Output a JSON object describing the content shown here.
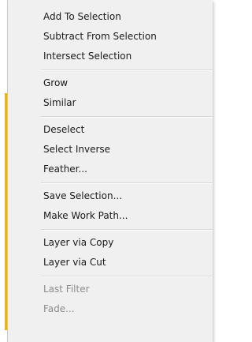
{
  "menu": {
    "groups": [
      {
        "items": [
          {
            "label": "Add To Selection",
            "enabled": true
          },
          {
            "label": "Subtract From Selection",
            "enabled": true
          },
          {
            "label": "Intersect Selection",
            "enabled": true
          }
        ]
      },
      {
        "items": [
          {
            "label": "Grow",
            "enabled": true
          },
          {
            "label": "Similar",
            "enabled": true
          }
        ]
      },
      {
        "items": [
          {
            "label": "Deselect",
            "enabled": true
          },
          {
            "label": "Select Inverse",
            "enabled": true
          },
          {
            "label": "Feather...",
            "enabled": true
          }
        ]
      },
      {
        "items": [
          {
            "label": "Save Selection...",
            "enabled": true
          },
          {
            "label": "Make Work Path...",
            "enabled": true
          }
        ]
      },
      {
        "items": [
          {
            "label": "Layer via Copy",
            "enabled": true
          },
          {
            "label": "Layer via Cut",
            "enabled": true
          }
        ]
      },
      {
        "items": [
          {
            "label": "Last Filter",
            "enabled": false
          },
          {
            "label": "Fade...",
            "enabled": false
          }
        ]
      }
    ]
  },
  "colors": {
    "menu_background": "#f0f0f0",
    "text": "#1a1a1a",
    "disabled_text": "#8c8c8c",
    "accent_bar": "#e4b422"
  }
}
